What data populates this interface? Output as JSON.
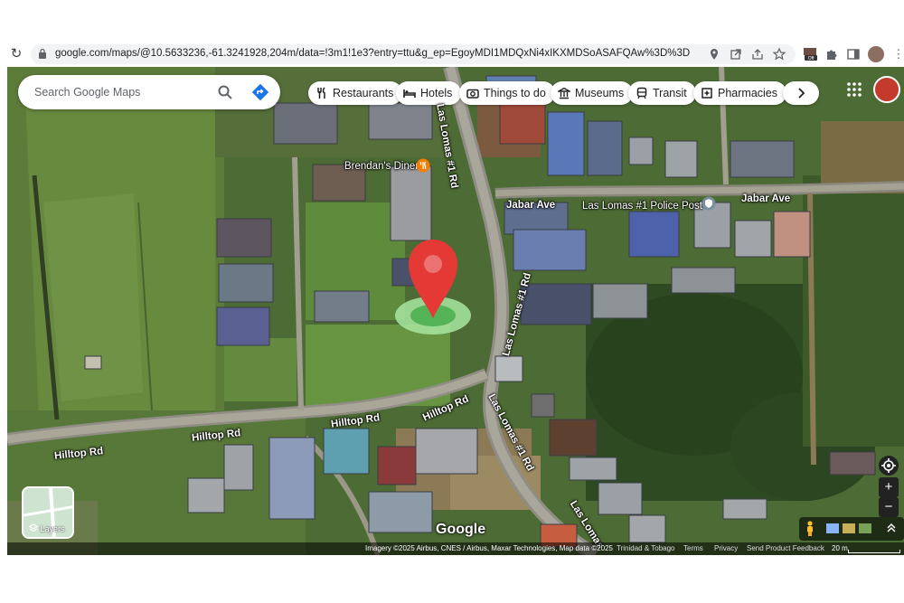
{
  "browser": {
    "url": "google.com/maps/@10.5633236,-61.3241928,204m/data=!3m1!1e3?entry=ttu&g_ep=EgoyMDI1MDQxNi4xIKXMDSoASAFQAw%3D%3D",
    "extension_badge": "Off"
  },
  "search": {
    "placeholder": "Search Google Maps"
  },
  "chips": [
    {
      "label": "Restaurants",
      "icon": "fork-knife-icon"
    },
    {
      "label": "Hotels",
      "icon": "bed-icon"
    },
    {
      "label": "Things to do",
      "icon": "camera-icon"
    },
    {
      "label": "Museums",
      "icon": "museum-icon"
    },
    {
      "label": "Transit",
      "icon": "train-icon"
    },
    {
      "label": "Pharmacies",
      "icon": "pharmacy-icon"
    }
  ],
  "map_labels": {
    "brendans_diner": "Brendan's Diner",
    "jabar_ave_1": "Jabar Ave",
    "jabar_ave_2": "Jabar Ave",
    "police_post": "Las Lomas #1 Police Post",
    "las_lomas_rd_1": "Las Lomas #1 Rd",
    "las_lomas_rd_2": "Las Lomas #1 Rd",
    "las_lomas_rd_3": "Las Lomas #1 Rd",
    "las_lomas_rd_4": "Las Lomas",
    "hilltop_rd_1": "Hilltop Rd",
    "hilltop_rd_2": "Hilltop Rd",
    "hilltop_rd_3": "Hilltop Rd",
    "hilltop_rd_4": "Hilltop Rd"
  },
  "layers": {
    "label": "Layers"
  },
  "google_logo": "Google",
  "footer": {
    "attribution": "Imagery ©2025 Airbus, CNES / Airbus, Maxar Technologies, Map data ©2025",
    "region": "Trinidad & Tobago",
    "terms": "Terms",
    "privacy": "Privacy",
    "feedback": "Send Product Feedback",
    "scale": "20 m"
  },
  "colors": {
    "pin_red": "#e53935",
    "pin_ring": "#a8e6a1"
  }
}
